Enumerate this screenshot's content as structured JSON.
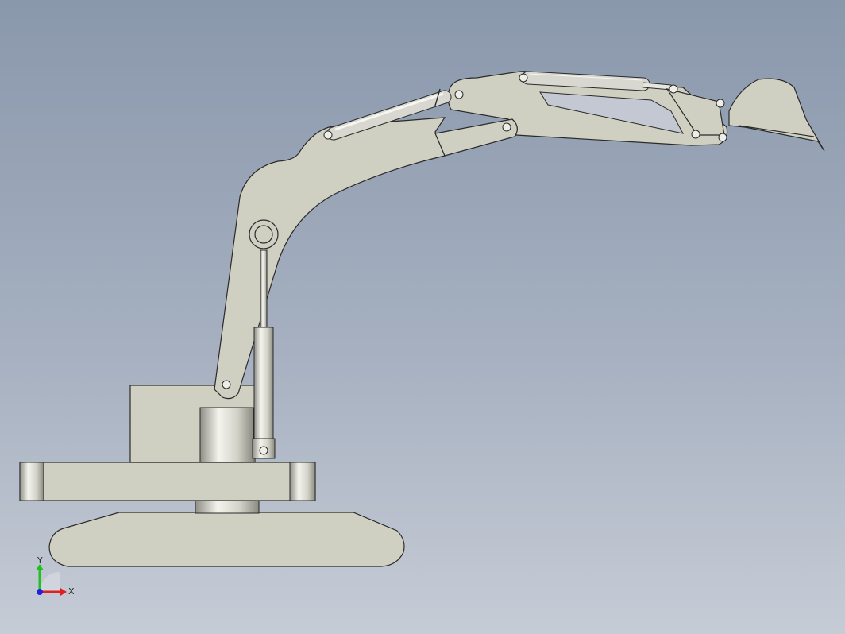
{
  "viewport": {
    "background_top": "#8a98ac",
    "background_bottom": "#c6ccd6"
  },
  "model": {
    "part_color": "#cfcfc2",
    "edge_color": "#2a2a2a",
    "cylinder_color": "#d6d6cf"
  },
  "triad": {
    "x_label": "X",
    "y_label": "Y",
    "x_color": "#e02020",
    "y_color": "#20c020",
    "z_color": "#2020e0"
  }
}
